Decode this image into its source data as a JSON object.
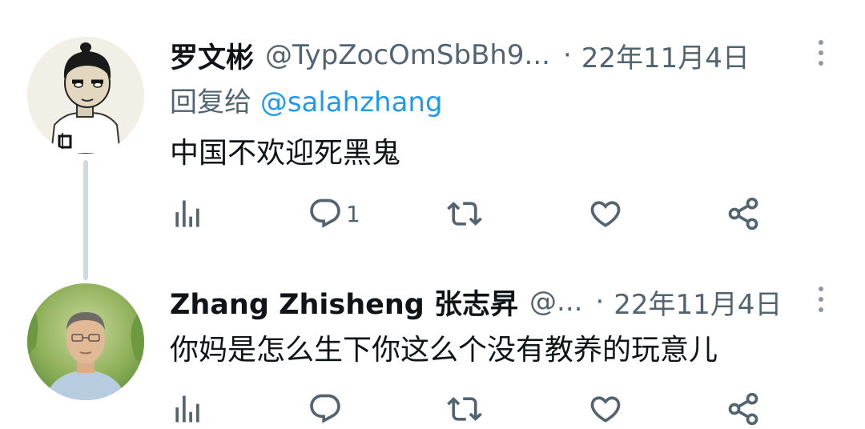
{
  "tweets": [
    {
      "name": "罗文彬",
      "handle": "@TypZocOmSbBh9...",
      "separator": "·",
      "date": "22年11月4日",
      "reply_prefix": "回复给",
      "reply_mention": "@salahzhang",
      "text": "中国不欢迎死黑鬼",
      "actions": {
        "views_icon": "bar-chart-icon",
        "reply_icon": "speech-bubble-icon",
        "reply_count": "1",
        "retweet_icon": "retweet-icon",
        "like_icon": "heart-icon",
        "share_icon": "share-icon"
      }
    },
    {
      "name": "Zhang Zhisheng 张志昇",
      "handle": "@...",
      "separator": "·",
      "date": "22年11月4日",
      "text": "你妈是怎么生下你这么个没有教养的玩意儿",
      "actions": {
        "views_icon": "bar-chart-icon",
        "reply_icon": "speech-bubble-icon",
        "retweet_icon": "retweet-icon",
        "like_icon": "heart-icon",
        "share_icon": "share-icon"
      }
    }
  ],
  "colors": {
    "name": "#0f1419",
    "secondary": "#536471",
    "mention": "#1d9bf0",
    "thread_line": "#cfd9de",
    "icon": "#536471"
  }
}
